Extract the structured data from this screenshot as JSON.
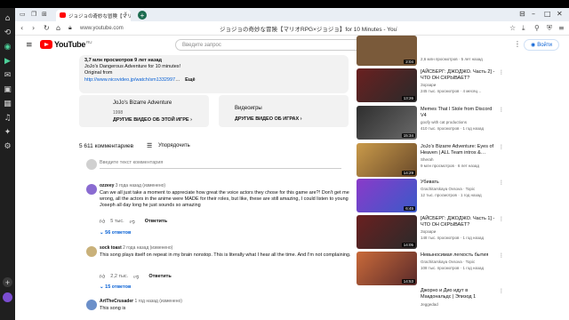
{
  "browser": {
    "tab_title": "ジョジョの奇妙な冒険【マリオRPG×ジョジョ】",
    "tab_close": "×",
    "new_tab": "+",
    "url": "www.youtube.com",
    "page_title": "ジョジョの奇妙な冒険【マリオRPG×ジョジョ】for 10 Minutes - YouTube"
  },
  "youtube": {
    "logo_text": "YouTube",
    "logo_region": "RU",
    "search_placeholder": "Введите запрос",
    "signin_label": "Войти"
  },
  "description": {
    "stats": "3,7 млн просмотров  9 лет назад",
    "line1": "JoJo's Dangerous Adventure for 10 minutes!",
    "line2": "Original from",
    "link": "http://www.nicovideo.jp/watch/sm1332997",
    "link_suffix": "…",
    "more": "Ещё"
  },
  "cards": [
    {
      "title": "JoJo's Bizarre Adventure",
      "year": "1998",
      "link": "ДРУГИЕ ВИДЕО ОБ ЭТОЙ ИГРЕ"
    },
    {
      "title": "Видеоигры",
      "link": "ДРУГИЕ ВИДЕО ОБ ИГРАХ"
    }
  ],
  "comments_header": {
    "count": "5 611 комментариев",
    "sort_label": "Упорядочить",
    "add_placeholder": "Введите текст комментария"
  },
  "comments": [
    {
      "author": "ozzeey",
      "time": "3 года назад (изменено)",
      "text": "Can we all just take a moment to appreciate how great the voice actors they chose for this game are?! Don't get me wrong, all the actors in the anime were MADE for their roles, but like, these are still amazing, I could listen to young Joseph all day long he just sounds so amazing",
      "likes": "5 тыс.",
      "reply": "Ответить",
      "replies": "56 ответов",
      "avatar_color": "#8a6bd1"
    },
    {
      "author": "sock toast",
      "time": "2 года назад (изменено)",
      "text": "This song plays itself on repeat in my brain nonstop. This is literally what I hear all the time. And I'm not complaining.",
      "likes": "2,2 тыс.",
      "reply": "Ответить",
      "replies": "15 ответов",
      "avatar_color": "#c9b17a"
    },
    {
      "author": "ArtTheCrusader",
      "time": "1 год назад (изменено)",
      "text": "This song is",
      "avatar_color": "#6b8fc9"
    }
  ],
  "recommendations": [
    {
      "title": "",
      "channel": "",
      "meta": "2,6 млн просмотров · 5 лет назад",
      "duration": "2:04",
      "thumb_color": "#7a5a3a"
    },
    {
      "title": "[АЙСБЕРГ: ДЖОДЖО. Часть 2] - ЧТО ОН СКРЫВАЕТ?",
      "channel": "Зорзари",
      "meta": "245 тыс. просмотров · 4 месяц…",
      "duration": "13:26",
      "thumb_color": "#5a2a2a"
    },
    {
      "title": "Memes That I Stole from Discord V4",
      "channel": "goofy with cat productions",
      "meta": "410 тыс. просмотров · 1 год назад",
      "duration": "15:34",
      "thumb_color": "#3a3a3a"
    },
    {
      "title": "JoJo's Bizarre Adventure: Eyes of Heaven | ALL Team intros &…",
      "channel": "Sherah",
      "meta": "9 млн просмотров · 6 лет назад",
      "duration": "14:29",
      "thumb_color": "#b88a4a"
    },
    {
      "title": "Убивать",
      "channel": "Grachitarskaya Ovsova · Topic",
      "meta": "12 тыс. просмотров · 1 год назад",
      "duration": "6:45",
      "thumb_color": "#6a3a8a"
    },
    {
      "title": "[АЙСБЕРГ: ДЖОДЖО. Часть 1] - ЧТО ОН СКРЫВАЕТ?",
      "channel": "Зорзари",
      "meta": "148 тыс. просмотров · 1 год назад",
      "duration": "14:05",
      "thumb_color": "#5a2a2a"
    },
    {
      "title": "Невыносимая легкость бытия",
      "channel": "Grachitarskaya Ovsova · Topic",
      "meta": "108 тыс. просмотров · 1 год назад",
      "duration": "14:53",
      "thumb_color": "#8a4a2a"
    },
    {
      "title": "Джорно и Дио идут в Макдональдс | Эпизод 1",
      "channel": "Jeggedad",
      "meta": "",
      "duration": "",
      "thumb_color": "#ffffff"
    }
  ]
}
